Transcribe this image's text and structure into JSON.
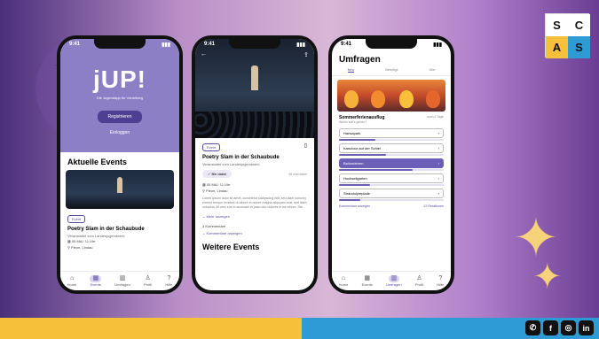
{
  "brand": {
    "logo_letters": [
      "S",
      "C",
      "A",
      "S"
    ],
    "colors": {
      "yellow": "#f6c03a",
      "blue": "#2f9bd4",
      "purple": "#5b4aa0"
    }
  },
  "socials": [
    {
      "name": "whatsapp-icon",
      "glyph": "✆"
    },
    {
      "name": "facebook-icon",
      "glyph": "f"
    },
    {
      "name": "instagram-icon",
      "glyph": "◎"
    },
    {
      "name": "linkedin-icon",
      "glyph": "in"
    }
  ],
  "phone1": {
    "time": "9:41",
    "logo": "jUP!",
    "subtitle": "Die Jugendapp für Vorarlberg",
    "register_button": "Registrieren",
    "login_link": "Einloggen",
    "section_title": "Aktuelle Events",
    "event": {
      "tag": "Event",
      "title": "Poetry Slam in der Schaubude",
      "subtitle": "Veranstaltet vom Landesjugendwerk",
      "date": "05.MAI, 11 Uhr",
      "place": "Pleon, Lindau"
    }
  },
  "phone2": {
    "time": "9:41",
    "tag": "Event",
    "title": "Poetry Slam in der Schaubude",
    "subtitle": "Veranstaltet vom Landesjugendwerk",
    "going": "Bin dabei",
    "going_count": "48 sind dabei",
    "date": "05.MAI, 11 Uhr",
    "place": "Pleon, Lindau",
    "description": "Lorem ipsum dolor sit amet, consetetur sadipscing elitr, sed diam nonumy eirmod tempor invidunt ut labore et dolore magna aliquyam erat, sed diam voluptua. At vero eos et accusam et justo duo dolores et ea rebum. Ste...",
    "more": "Mehr anzeigen",
    "comments_count": "3 Kommentare",
    "comments_link": "Kommentare anzeigen",
    "section_title": "Weitere Events"
  },
  "phone3": {
    "time": "9:41",
    "title": "Umfragen",
    "tabs": [
      "Neu",
      "Beteiligt",
      "Alle"
    ],
    "question": "Sommerferienausflug",
    "question_time": "noch 2 Tage",
    "hint": "Wohin soll's gehen?",
    "options": [
      {
        "label": "Hansapark",
        "fraction": 0.35,
        "selected": false
      },
      {
        "label": "Kanutour auf der Schlei",
        "fraction": 0.45,
        "selected": false
      },
      {
        "label": "Ballonfahren",
        "fraction": 0.7,
        "selected": true
      },
      {
        "label": "Hochseilgarten",
        "fraction": 0.3,
        "selected": false
      },
      {
        "label": "Strandolympiade",
        "fraction": 0.2,
        "selected": false
      }
    ],
    "comments_link": "Kommentare anzeigen",
    "reactions": "22 Reaktionen"
  },
  "tabbar": [
    "Home",
    "Events",
    "Umfragen",
    "Profil",
    "Hilfe"
  ]
}
